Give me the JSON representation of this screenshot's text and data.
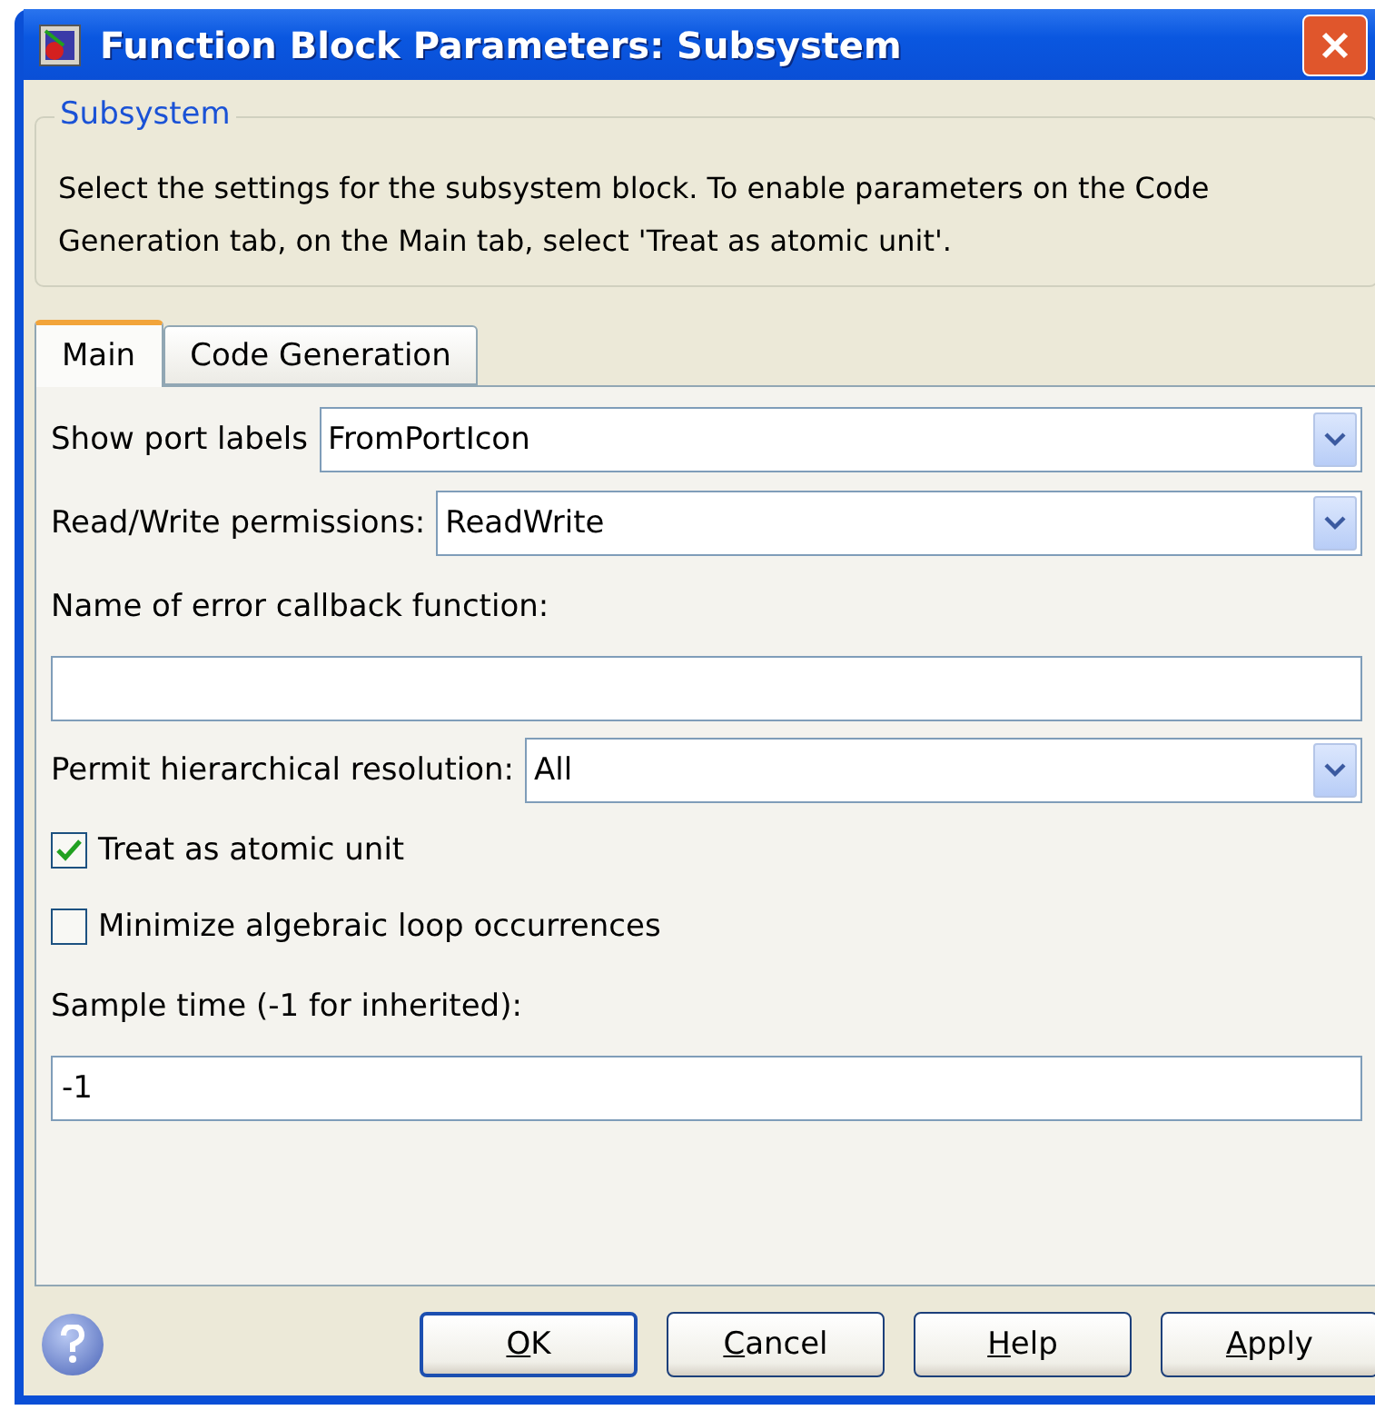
{
  "window": {
    "title": "Function Block Parameters: Subsystem"
  },
  "group": {
    "title": "Subsystem",
    "description": "Select the settings for the subsystem block. To enable parameters on the Code Generation tab, on the Main tab, select 'Treat as atomic unit'."
  },
  "tabs": [
    {
      "label": "Main",
      "selected": true
    },
    {
      "label": "Code Generation",
      "selected": false
    }
  ],
  "fields": [
    {
      "kind": "dropdown",
      "label": "Show port labels",
      "value": "FromPortIcon"
    },
    {
      "kind": "dropdown",
      "label": "Read/Write permissions:",
      "value": "ReadWrite"
    },
    {
      "kind": "text",
      "label": "Name of error callback function:"
    },
    {
      "kind": "dropdown",
      "label": "Permit hierarchical resolution:",
      "value": "All"
    },
    {
      "kind": "checkbox",
      "label": "Treat as atomic unit",
      "checked": true
    },
    {
      "kind": "checkbox",
      "label": "Minimize algebraic loop occurrences",
      "checked": false
    },
    {
      "kind": "text",
      "label": "Sample time (-1 for inherited):",
      "value": "-1"
    }
  ],
  "buttons": [
    {
      "key": "O",
      "rest": "K",
      "default": true
    },
    {
      "key": "C",
      "rest": "ancel",
      "default": false
    },
    {
      "key": "H",
      "rest": "elp",
      "default": false
    },
    {
      "key": "A",
      "rest": "pply",
      "default": false
    }
  ]
}
